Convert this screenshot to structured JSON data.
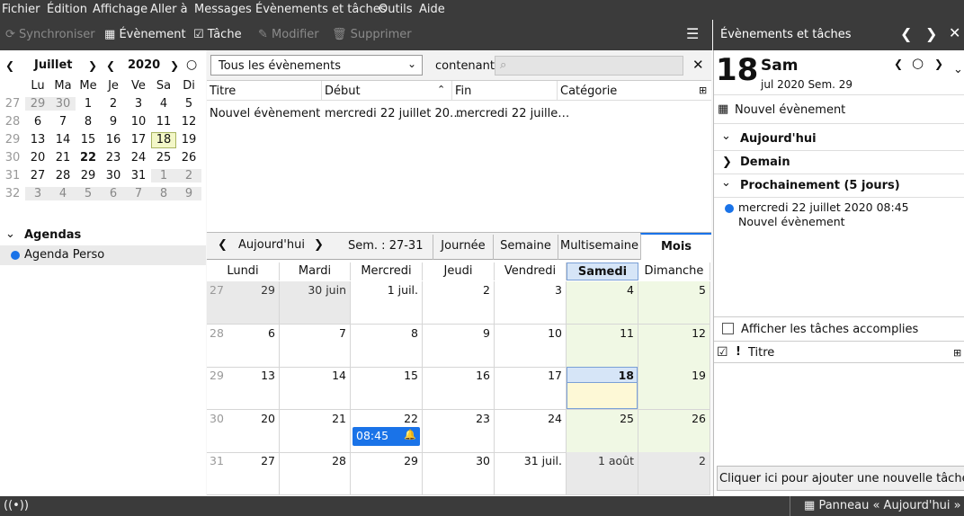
{
  "menu": [
    "Fichier",
    "Édition",
    "Affichage",
    "Aller à",
    "Messages",
    "Évènements et tâches",
    "Outils",
    "Aide"
  ],
  "toolbar": {
    "sync": "Synchroniser",
    "event": "Évènement",
    "task": "Tâche",
    "edit": "Modifier",
    "delete": "Supprimer"
  },
  "sidebar_title": "Évènements et tâches",
  "mini": {
    "month": "Juillet",
    "year": "2020",
    "days": [
      "Lu",
      "Ma",
      "Me",
      "Je",
      "Ve",
      "Sa",
      "Di"
    ],
    "weeks": [
      {
        "wk": "27",
        "d": [
          "29",
          "30",
          "1",
          "2",
          "3",
          "4",
          "5"
        ]
      },
      {
        "wk": "28",
        "d": [
          "6",
          "7",
          "8",
          "9",
          "10",
          "11",
          "12"
        ]
      },
      {
        "wk": "29",
        "d": [
          "13",
          "14",
          "15",
          "16",
          "17",
          "18",
          "19"
        ]
      },
      {
        "wk": "30",
        "d": [
          "20",
          "21",
          "22",
          "23",
          "24",
          "25",
          "26"
        ]
      },
      {
        "wk": "31",
        "d": [
          "27",
          "28",
          "29",
          "30",
          "31",
          "1",
          "2"
        ]
      },
      {
        "wk": "32",
        "d": [
          "3",
          "4",
          "5",
          "6",
          "7",
          "8",
          "9"
        ]
      }
    ]
  },
  "agendas": {
    "title": "Agendas",
    "items": [
      {
        "name": "Agenda Perso",
        "color": "#1a73e8"
      }
    ]
  },
  "filter": {
    "selected": "Tous les évènements",
    "contains": "contenant",
    "search_placeholder": ""
  },
  "list": {
    "headers": [
      "Titre",
      "Début",
      "Fin",
      "Catégorie"
    ],
    "rows": [
      {
        "title": "Nouvel évènement",
        "start": "mercredi 22 juillet 20…",
        "end": "mercredi 22 juille…",
        "category": ""
      }
    ]
  },
  "calnav": {
    "today": "Aujourd'hui",
    "week": "Sem. : 27-31",
    "tabs": [
      "Journée",
      "Semaine",
      "Multisemaine",
      "Mois"
    ],
    "active_tab": "Mois"
  },
  "month": {
    "days": [
      "Lundi",
      "Mardi",
      "Mercredi",
      "Jeudi",
      "Vendredi",
      "Samedi",
      "Dimanche"
    ],
    "weeks": [
      {
        "wk": "27",
        "d": [
          "29",
          "30 juin",
          "1 juil.",
          "2",
          "3",
          "4",
          "5"
        ]
      },
      {
        "wk": "28",
        "d": [
          "6",
          "7",
          "8",
          "9",
          "10",
          "11",
          "12"
        ]
      },
      {
        "wk": "29",
        "d": [
          "13",
          "14",
          "15",
          "16",
          "17",
          "18",
          "19"
        ]
      },
      {
        "wk": "30",
        "d": [
          "20",
          "21",
          "22",
          "23",
          "24",
          "25",
          "26"
        ]
      },
      {
        "wk": "31",
        "d": [
          "27",
          "28",
          "29",
          "30",
          "31 juil.",
          "1 août",
          "2"
        ]
      }
    ],
    "event": {
      "time": "08:45"
    }
  },
  "today": {
    "day": "18",
    "weekday": "Sam",
    "sub": "jul 2020 Sem. 29",
    "new_event": "Nouvel évènement",
    "sections": [
      "Aujourd'hui",
      "Demain",
      "Prochainement (5 jours)"
    ],
    "upcoming": {
      "date": "mercredi 22 juillet 2020 08:45",
      "title": "Nouvel évènement"
    },
    "show_done": "Afficher les tâches accomplies",
    "task_header": "Titre",
    "add_task": "Cliquer ici pour ajouter une nouvelle tâche"
  },
  "status": {
    "panel": "Panneau « Aujourd'hui »"
  }
}
